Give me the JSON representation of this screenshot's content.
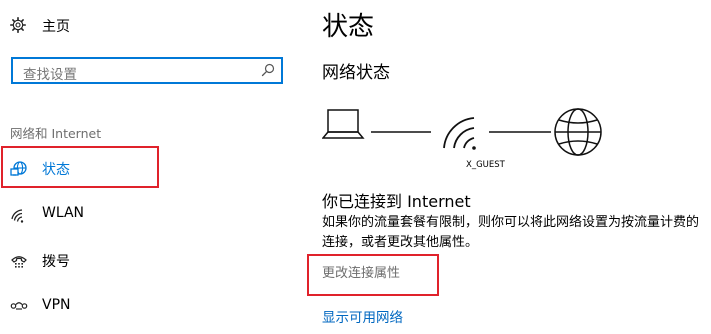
{
  "sidebar": {
    "home_label": "主页",
    "search_placeholder": "查找设置",
    "group_heading": "网络和 Internet",
    "items": [
      {
        "label": "状态",
        "icon": "ethernet-globe-icon",
        "selected": true
      },
      {
        "label": "WLAN",
        "icon": "wifi-icon",
        "selected": false
      },
      {
        "label": "拨号",
        "icon": "dialup-phone-icon",
        "selected": false
      },
      {
        "label": "VPN",
        "icon": "vpn-icon",
        "selected": false
      }
    ]
  },
  "main": {
    "title": "状态",
    "section_title": "网络状态",
    "network_name": "X_GUEST",
    "status_heading": "你已连接到 Internet",
    "status_description": "如果你的流量套餐有限制，则你可以将此网络设置为按流量计费的连接，或者更改其他属性。",
    "change_properties_link": "更改连接属性",
    "show_networks_link": "显示可用网络"
  },
  "colors": {
    "accent": "#0078d7",
    "link": "#0067c0",
    "highlight": "#e0222b",
    "muted_text": "#6e6e6e"
  }
}
